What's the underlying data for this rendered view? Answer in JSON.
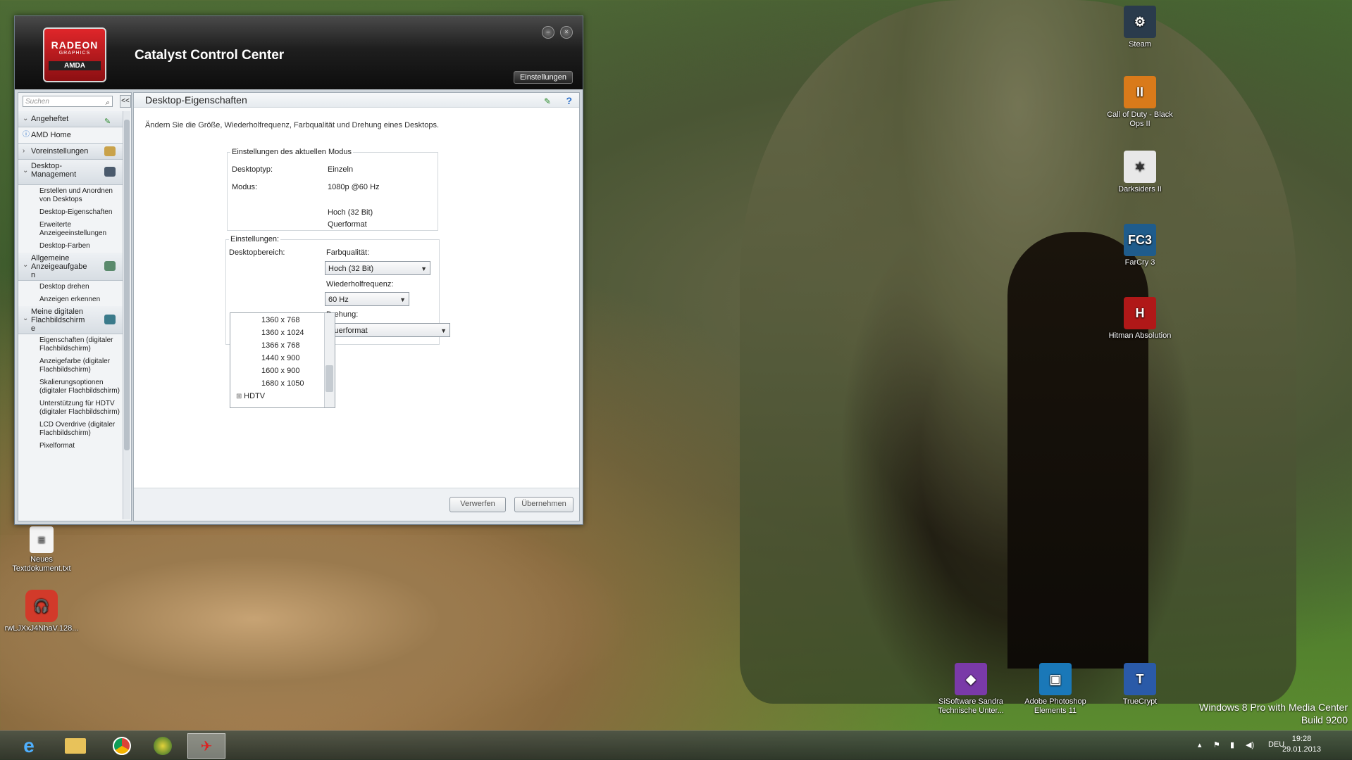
{
  "window": {
    "title": "Catalyst Control Center",
    "settings_button": "Einstellungen",
    "logo": {
      "brand": "RADEON",
      "sub": "GRAPHICS",
      "vendor": "AMDA"
    },
    "minimize": "–",
    "close": "×"
  },
  "sidebar": {
    "search_placeholder": "Suchen",
    "collapse_label": "<<",
    "sections": {
      "pinned": "Angeheftet",
      "amd_home": "AMD Home",
      "presets": "Voreinstellungen",
      "desktop_mgmt": "Desktop-\nManagement",
      "common_display": "Allgemeine\nAnzeigeaufgabe\nn",
      "digital_flat": "Meine digitalen\nFlachbildschirm\ne"
    },
    "desktop_items": [
      "Erstellen und Anordnen von Desktops",
      "Desktop-Eigenschaften",
      "Erweiterte Anzeigeeinstellungen",
      "Desktop-Farben"
    ],
    "display_items": [
      "Desktop drehen",
      "Anzeigen erkennen"
    ],
    "flat_items": [
      "Eigenschaften (digitaler Flachbildschirm)",
      "Anzeigefarbe (digitaler Flachbildschirm)",
      "Skalierungsoptionen (digitaler Flachbildschirm)",
      "Unterstützung für HDTV (digitaler Flachbildschirm)",
      "LCD Overdrive (digitaler Flachbildschirm)",
      "Pixelformat"
    ]
  },
  "main": {
    "heading": "Desktop-Eigenschaften",
    "description": "Ändern Sie die Größe, Wiederholfrequenz, Farbqualität und Drehung eines Desktops.",
    "current_mode": {
      "title": "Einstellungen des aktuellen Modus",
      "desktop_type_label": "Desktoptyp:",
      "desktop_type_value": "Einzeln",
      "mode_label": "Modus:",
      "mode_value": "1080p @60 Hz",
      "color_value": "Hoch (32 Bit)",
      "orientation_value": "Querformat"
    },
    "settings": {
      "title": "Einstellungen:",
      "area_label": "Desktopbereich:",
      "resolutions": [
        "1360 x  768",
        "1360 x 1024",
        "1366 x  768",
        "1440 x  900",
        "1600 x  900",
        "1680 x 1050"
      ],
      "hdtv_node": "HDTV",
      "color_label": "Farbqualität:",
      "color_value": "Hoch (32 Bit)",
      "refresh_label": "Wiederholfrequenz:",
      "refresh_value": "60 Hz",
      "rotation_label": "Drehung:",
      "rotation_value": "Querformat"
    },
    "discard": "Verwerfen",
    "apply": "Übernehmen"
  },
  "desktop": {
    "icons": [
      {
        "label": "Steam",
        "color": "#2a3b4c"
      },
      {
        "label": "Call of Duty - Black Ops II",
        "color": "#d97a1a"
      },
      {
        "label": "Darksiders II",
        "color": "#e8e8e8"
      },
      {
        "label": "FarCry 3",
        "color": "#1f5c8c"
      },
      {
        "label": "Hitman Absolution",
        "color": "#b01818"
      },
      {
        "label": "SiSoftware Sandra Technische Unter...",
        "color": "#7a3aa8"
      },
      {
        "label": "Adobe Photoshop Elements 11",
        "color": "#1a78b8"
      },
      {
        "label": "TrueCrypt",
        "color": "#2a5aa8"
      },
      {
        "label": "Neues Textdokument.txt",
        "color": "#f4f4f4"
      },
      {
        "label": "rwLJXxJ4NhaV.128...",
        "color": "#d23a2a"
      }
    ],
    "watermark_line1": "Windows 8 Pro with Media Center",
    "watermark_line2": "Build 9200"
  },
  "taskbar": {
    "language": "DEU",
    "time": "19:28",
    "date": "29.01.2013"
  }
}
